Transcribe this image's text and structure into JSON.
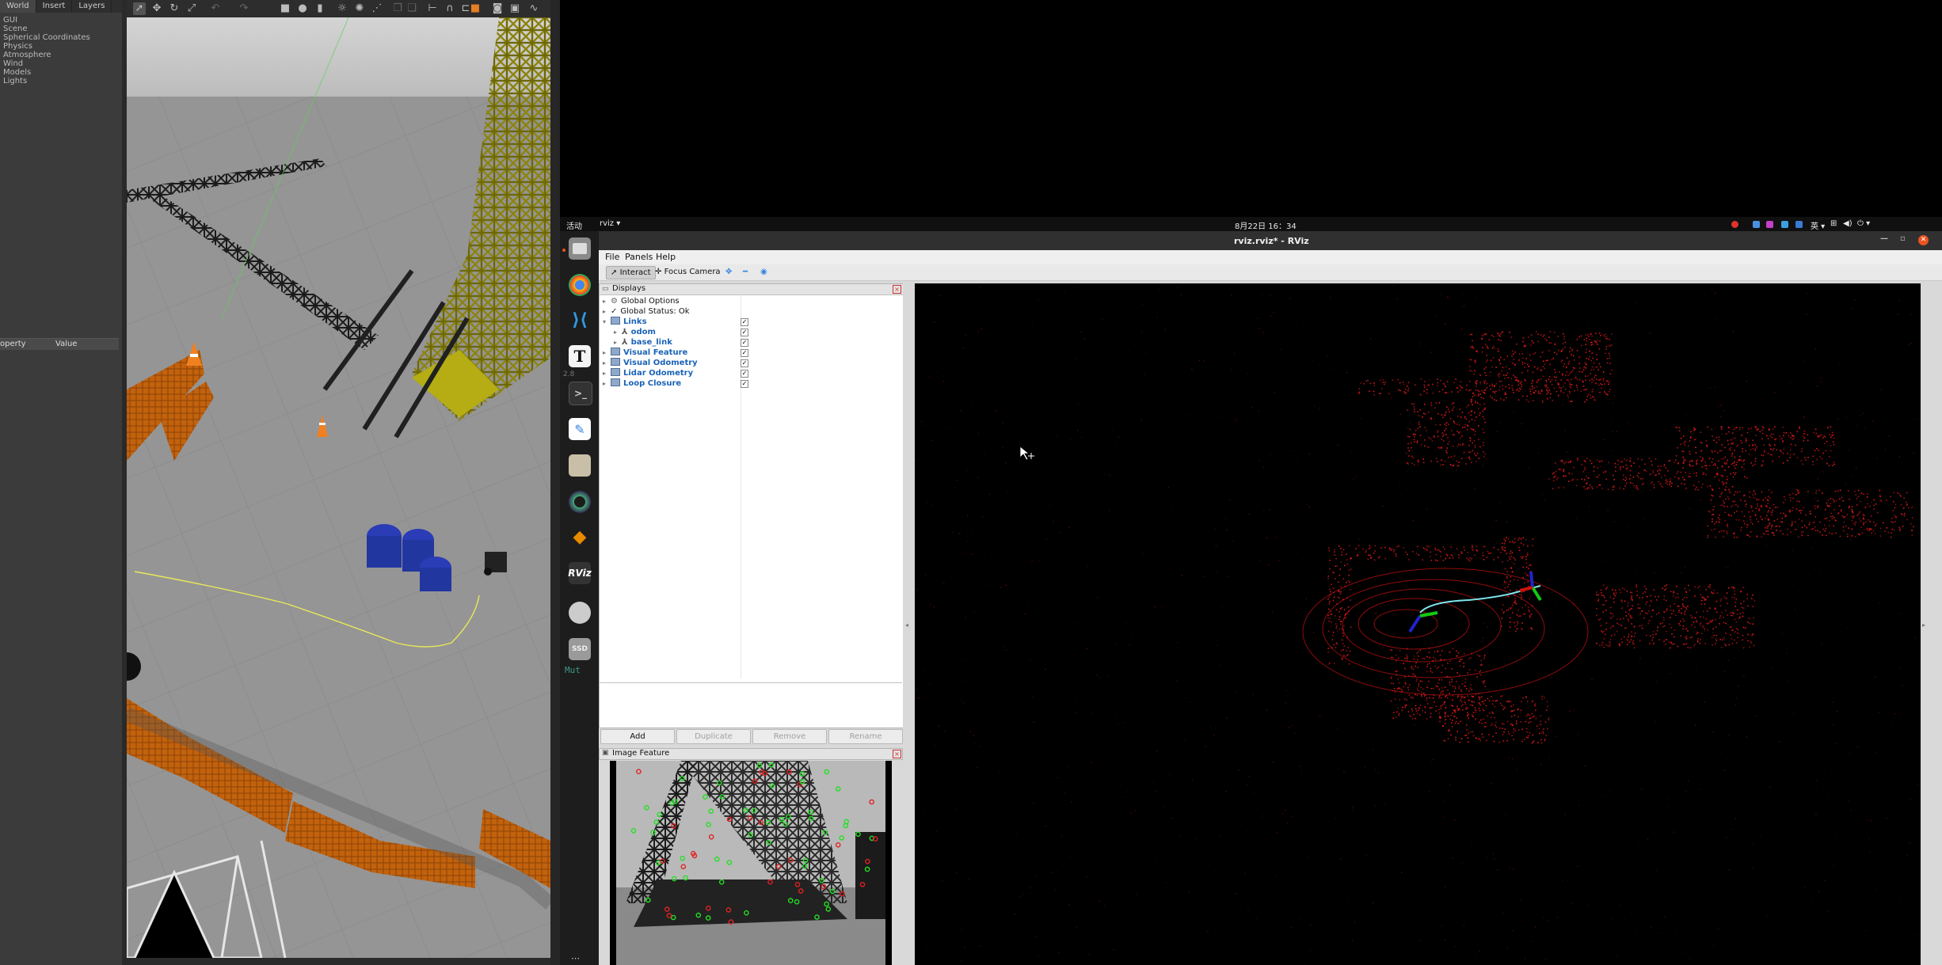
{
  "gazebo": {
    "tabs": [
      "World",
      "Insert",
      "Layers"
    ],
    "tree_items": [
      "GUI",
      "Scene",
      "Spherical Coordinates",
      "Physics",
      "Atmosphere",
      "Wind",
      "Models",
      "Lights"
    ],
    "property_header": "operty",
    "value_header": "Value",
    "toolbar_icons": [
      "select-icon",
      "translate-icon",
      "rotate-icon",
      "scale-icon",
      "undo-icon",
      "redo-icon",
      "box-icon",
      "sphere-icon",
      "cylinder-icon",
      "sun-light-icon",
      "point-light-icon",
      "spot-light-icon",
      "copy-icon",
      "paste-icon",
      "align-icon",
      "snap-icon",
      "magnet-icon",
      "screenshot-icon",
      "record-icon",
      "plot-icon"
    ]
  },
  "topbar": {
    "activities": "活动",
    "app": "rviz ▾",
    "clock": "8月22日 16：34",
    "ime": "英 ▾",
    "tray_colors": [
      "#e0332e",
      "#4a90e2",
      "#c63ec9",
      "#3aa0e0",
      "#3a7bd5"
    ]
  },
  "dock": {
    "items": [
      "files-icon",
      "chrome-icon",
      "vscode-icon",
      "typora-icon",
      "terminal-icon",
      "text-editor-icon",
      "notes-icon",
      "camera-icon",
      "layers-icon",
      "rviz-icon",
      "disk-icon",
      "ssd-icon"
    ],
    "typora_letter": "T",
    "rviz_label": "RViz",
    "ssd_label": "SSD",
    "mut_label": "Mut",
    "version_label": "2.8"
  },
  "rviz": {
    "title": "rviz.rviz* - RViz",
    "menu": [
      "File",
      "Panels",
      "Help"
    ],
    "toolbar": {
      "interact": "Interact",
      "focus_camera": "Focus Camera"
    },
    "displays": {
      "panel_title": "Displays",
      "rows": [
        {
          "label": "Global Options",
          "blue": false,
          "icon": "gear",
          "indent": 0,
          "check": false
        },
        {
          "label": "Global Status: Ok",
          "blue": false,
          "icon": "check",
          "indent": 0,
          "check": false
        },
        {
          "label": "Links",
          "blue": true,
          "icon": "folder",
          "indent": 0,
          "check": true
        },
        {
          "label": "odom",
          "blue": true,
          "icon": "axes",
          "indent": 1,
          "check": true
        },
        {
          "label": "base_link",
          "blue": true,
          "icon": "axes",
          "indent": 1,
          "check": true
        },
        {
          "label": "Visual Feature",
          "blue": true,
          "icon": "folder",
          "indent": 0,
          "check": true
        },
        {
          "label": "Visual Odometry",
          "blue": true,
          "icon": "folder",
          "indent": 0,
          "check": true
        },
        {
          "label": "Lidar Odometry",
          "blue": true,
          "icon": "folder",
          "indent": 0,
          "check": true
        },
        {
          "label": "Loop Closure",
          "blue": true,
          "icon": "folder",
          "indent": 0,
          "check": true
        }
      ],
      "buttons": {
        "add": "Add",
        "duplicate": "Duplicate",
        "remove": "Remove",
        "rename": "Rename"
      }
    },
    "image_panel_title": "Image Feature"
  }
}
